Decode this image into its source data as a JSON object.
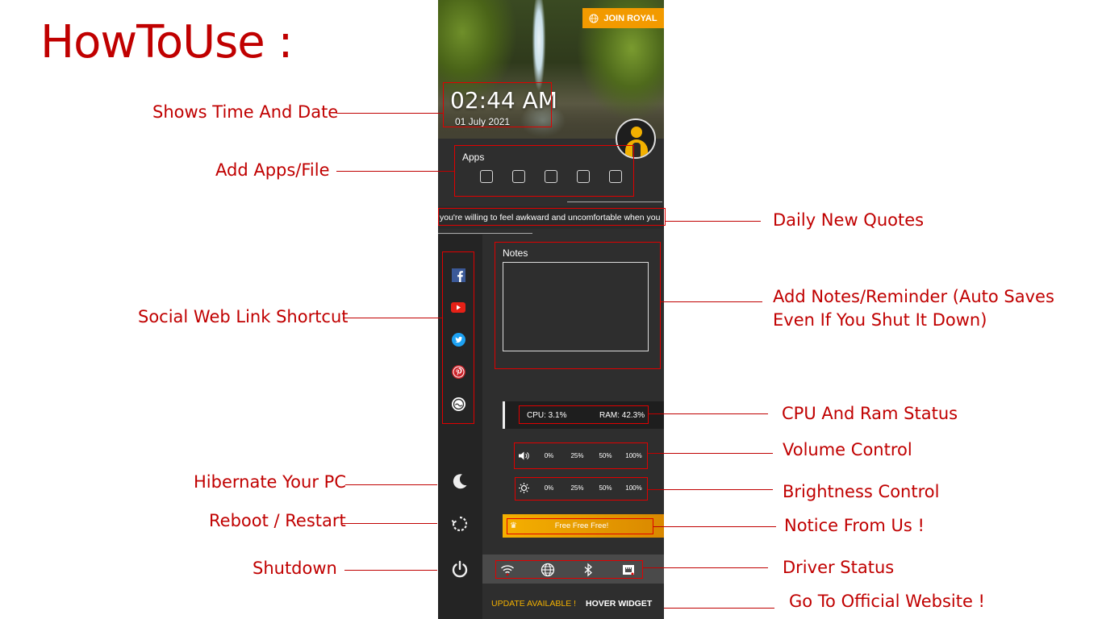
{
  "page_title": "HowToUse :",
  "callouts": {
    "time_date": "Shows Time And Date",
    "apps": "Add Apps/File",
    "quotes": "Daily New Quotes",
    "social": "Social Web Link Shortcut",
    "notes_line1": "Add Notes/Reminder (Auto Saves",
    "notes_line2": "Even If You Shut It Down)",
    "cpu_ram": "CPU And Ram Status",
    "volume": "Volume Control",
    "hibernate": "Hibernate Your PC",
    "brightness": "Brightness Control",
    "reboot": "Reboot / Restart",
    "notice": "Notice From Us !",
    "shutdown": "Shutdown",
    "drivers": "Driver Status",
    "website": "Go To Official Website !"
  },
  "widget": {
    "join_label": "JOIN ROYAL",
    "time": "02:44 AM",
    "date": "01 July 2021",
    "apps_label": "Apps",
    "quote": "you're willing to feel awkward and uncomfortable when you",
    "notes_label": "Notes",
    "cpu": "CPU: 3.1%",
    "ram": "RAM: 42.3%",
    "volume_levels": [
      "0%",
      "25%",
      "50%",
      "100%"
    ],
    "brightness_levels": [
      "0%",
      "25%",
      "50%",
      "100%"
    ],
    "notice_text": "Free Free Free!",
    "update_label": "UPDATE AVAILABLE !",
    "hover_label": "HOVER WIDGET"
  },
  "icons": {
    "social": [
      "facebook-icon",
      "youtube-icon",
      "twitter-icon",
      "pinterest-icon",
      "website-icon"
    ],
    "power": [
      "moon-icon",
      "restart-icon",
      "power-icon"
    ],
    "drivers": [
      "wifi-icon",
      "globe-icon",
      "bluetooth-icon",
      "ethernet-icon"
    ]
  },
  "colors": {
    "annotation": "#c00000",
    "highlight": "#e00000",
    "accent_orange": "#f29a00",
    "update_yellow": "#f2b000",
    "widget_bg": "#2e2e2e"
  }
}
